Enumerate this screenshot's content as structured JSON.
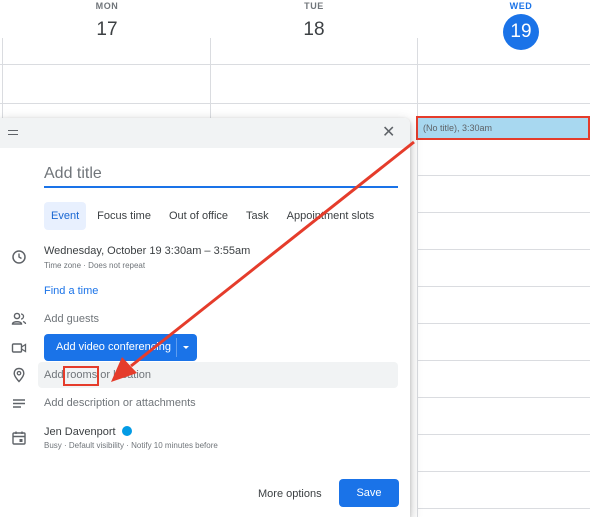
{
  "calendar": {
    "days": [
      {
        "name": "MON",
        "num": "17"
      },
      {
        "name": "TUE",
        "num": "18"
      },
      {
        "name": "WED",
        "num": "19"
      }
    ],
    "event_chip": "(No title), 3:30am"
  },
  "dialog": {
    "title_placeholder": "Add title",
    "tabs": [
      "Event",
      "Focus time",
      "Out of office",
      "Task",
      "Appointment slots"
    ],
    "datetime": "Wednesday, October 19   3:30am  –  3:55am",
    "datetime_sub": "Time zone · Does not repeat",
    "find_time": "Find a time",
    "add_guests": "Add guests",
    "video_button": "Add video conferencing",
    "location_prefix": "Add ",
    "location_highlight": "rooms",
    "location_suffix": " or location",
    "description": "Add description or attachments",
    "owner_name": "Jen Davenport",
    "owner_sub": "Busy · Default visibility · Notify 10 minutes before",
    "more_options": "More options",
    "save": "Save"
  },
  "colors": {
    "accent": "#1a73e8",
    "annotation": "#e53c2b",
    "event_chip": "#a8d8f0",
    "owner_calendar": "#039be5"
  },
  "icons": [
    "drag-handle-icon",
    "close-icon",
    "clock-icon",
    "people-icon",
    "video-camera-icon",
    "location-pin-icon",
    "description-icon",
    "calendar-icon",
    "dropdown-caret-icon"
  ]
}
